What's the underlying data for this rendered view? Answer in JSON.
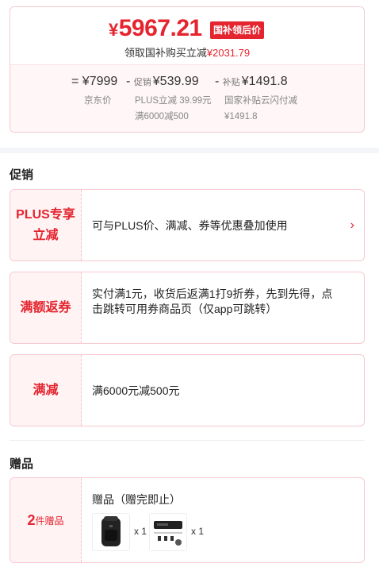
{
  "price": {
    "currency": "¥",
    "final": "5967.21",
    "tag": "国补领后价",
    "save_prefix": "领取国补购买立减",
    "save_amount": "¥2031.79"
  },
  "breakdown": {
    "eq": "=",
    "base": "¥7999",
    "base_label": "京东价",
    "minus1": "-",
    "promo_tag": "促销",
    "promo_amount": "¥539.99",
    "promo_note1": "PLUS立减 39.99元",
    "promo_note2": "满6000减500",
    "minus2": "-",
    "subsidy_tag": "补贴",
    "subsidy_amount": "¥1491.8",
    "subsidy_note1": "国家补贴云闪付减",
    "subsidy_note2": "¥1491.8"
  },
  "promotions": {
    "title": "促销",
    "items": [
      {
        "label": "PLUS专享\n立减",
        "text": "可与PLUS价、满减、券等优惠叠加使用",
        "arrow": "›"
      },
      {
        "label": "满额返券",
        "text": "实付满1元，收货后返满1打9折券，先到先得，点击跳转可用券商品页（仅app可跳转）"
      },
      {
        "label": "满减",
        "text": "满6000元减500元"
      }
    ]
  },
  "gifts": {
    "title": "赠品",
    "count": "2",
    "unit": "件赠品",
    "head": "赠品（赠完即止）",
    "items": [
      {
        "icon": "backpack-icon",
        "qty": "x 1"
      },
      {
        "icon": "device-kit-icon",
        "qty": "x 1"
      }
    ]
  },
  "colors": {
    "accent": "#e4242e",
    "label_bg": "#fff3f4",
    "border": "#f6c9cf"
  }
}
